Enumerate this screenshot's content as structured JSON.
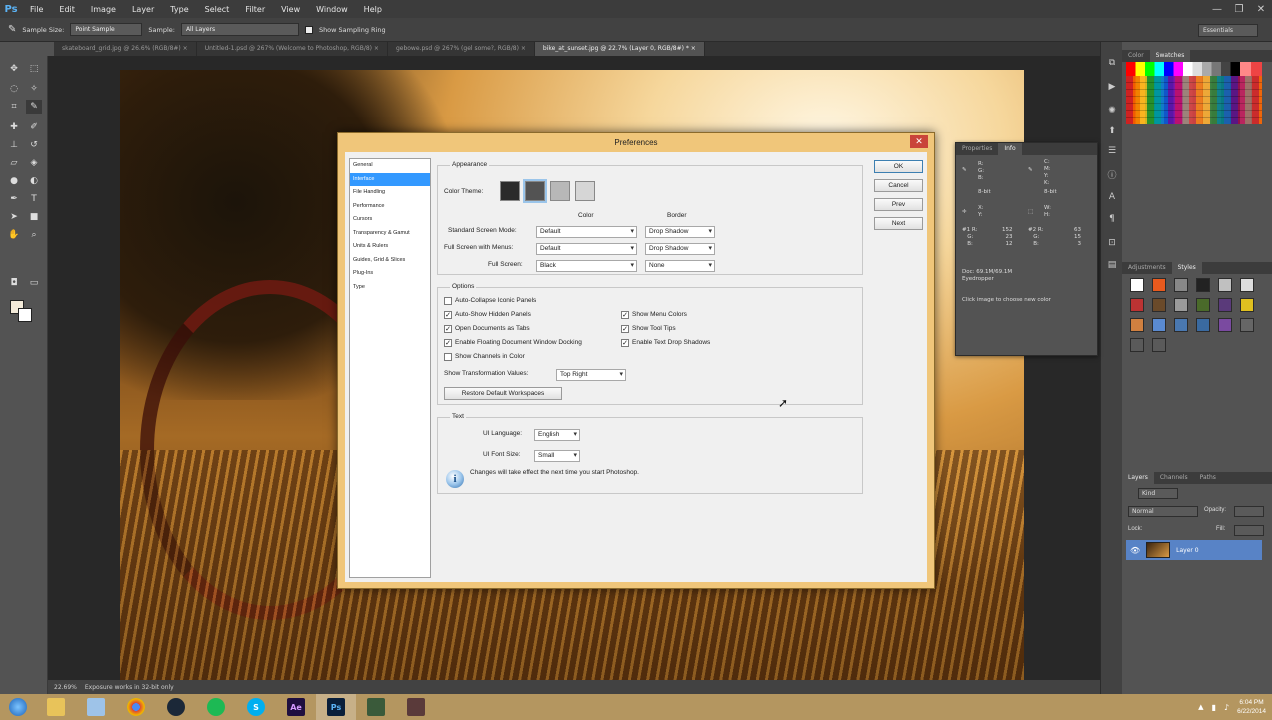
{
  "app": {
    "logo": "Ps",
    "menus": [
      "File",
      "Edit",
      "Image",
      "Layer",
      "Type",
      "Select",
      "Filter",
      "View",
      "Window",
      "Help"
    ],
    "window_controls": {
      "minimize": "—",
      "restore": "❐",
      "close": "✕"
    }
  },
  "options_bar": {
    "sample_size_label": "Sample Size:",
    "sample_size_value": "Point Sample",
    "sample_label": "Sample:",
    "sample_value": "All Layers",
    "show_sampling_ring": "Show Sampling Ring",
    "workspace": "Essentials"
  },
  "tabs": [
    {
      "label": "skateboard_grid.jpg @ 26.6% (RGB/8#) ×"
    },
    {
      "label": "Untitled-1.psd @ 267% (Welcome to Photoshop, RGB/8) ×"
    },
    {
      "label": "gebowe.psd @ 267% (gel some?, RGB/8) ×"
    },
    {
      "label": "bike_at_sunset.jpg @ 22.7% (Layer 0, RGB/8#) *  ×"
    }
  ],
  "status_bar": {
    "zoom": "22.69%",
    "info": "Exposure works in 32-bit only"
  },
  "swatches_panel": {
    "tabs": [
      "Color",
      "Swatches"
    ]
  },
  "styles_panel": {
    "tabs": [
      "Adjustments",
      "Styles"
    ]
  },
  "layers_panel": {
    "tabs": [
      "Layers",
      "Channels",
      "Paths"
    ],
    "kind": "Kind",
    "blend_mode": "Normal",
    "opacity_label": "Opacity:",
    "lock_label": "Lock:",
    "fill_label": "Fill:",
    "layer_name": "Layer 0"
  },
  "info_panel": {
    "tabs": [
      "Properties",
      "Info"
    ],
    "rgb_labels": "R:\nG:\nB:",
    "cmyk_labels": "C:\nM:\nY:\nK:",
    "bit_depth_1": "8-bit",
    "bit_depth_2": "8-bit",
    "xy_labels": "X:\nY:",
    "wh_labels": "W:\nH:",
    "sample1": "#1 R:\n   G:\n   B:",
    "sample1_values": "152\n23\n12",
    "sample2": "#2 R:\n   G:\n   B:",
    "sample2_values": "63\n15\n3",
    "doc_info": "Doc: 69.1M/69.1M",
    "tool_info": "Eyedropper",
    "hint": "Click image to choose new color"
  },
  "preferences": {
    "title": "Preferences",
    "close": "✕",
    "sidebar": [
      "General",
      "Interface",
      "File Handling",
      "Performance",
      "Cursors",
      "Transparency & Gamut",
      "Units & Rulers",
      "Guides, Grid & Slices",
      "Plug-Ins",
      "Type"
    ],
    "selected_index": 1,
    "appearance": {
      "legend": "Appearance",
      "color_theme_label": "Color Theme:",
      "color_header": "Color",
      "border_header": "Border",
      "standard_label": "Standard Screen Mode:",
      "standard_color": "Default",
      "standard_border": "Drop Shadow",
      "fullmenus_label": "Full Screen with Menus:",
      "fullmenus_color": "Default",
      "fullmenus_border": "Drop Shadow",
      "fullscreen_label": "Full Screen:",
      "fullscreen_color": "Black",
      "fullscreen_border": "None"
    },
    "options": {
      "legend": "Options",
      "auto_collapse": "Auto-Collapse Iconic Panels",
      "auto_show": "Auto-Show Hidden Panels",
      "open_tabs": "Open Documents as Tabs",
      "floating_docking": "Enable Floating Document Window Docking",
      "show_channels": "Show Channels in Color",
      "show_menu_colors": "Show Menu Colors",
      "show_tool_tips": "Show Tool Tips",
      "text_drop_shadows": "Enable Text Drop Shadows",
      "transform_label": "Show Transformation Values:",
      "transform_value": "Top Right",
      "restore_button": "Restore Default Workspaces"
    },
    "text": {
      "legend": "Text",
      "ui_language_label": "UI Language:",
      "ui_language": "English",
      "ui_font_size_label": "UI Font Size:",
      "ui_font_size": "Small",
      "note": "Changes will take effect the next time you start Photoshop."
    },
    "buttons": {
      "ok": "OK",
      "cancel": "Cancel",
      "prev": "Prev",
      "next": "Next"
    }
  },
  "taskbar": {
    "apps": [
      "Ps",
      "Ae"
    ],
    "time": "6:04 PM",
    "date": "6/22/2014"
  },
  "colors": {
    "ps_dark": "#3c3c3c",
    "ps_panel": "#535353",
    "dialog_frame": "#f0c67a",
    "selection_blue": "#3399ff",
    "taskbar": "#b49660"
  }
}
